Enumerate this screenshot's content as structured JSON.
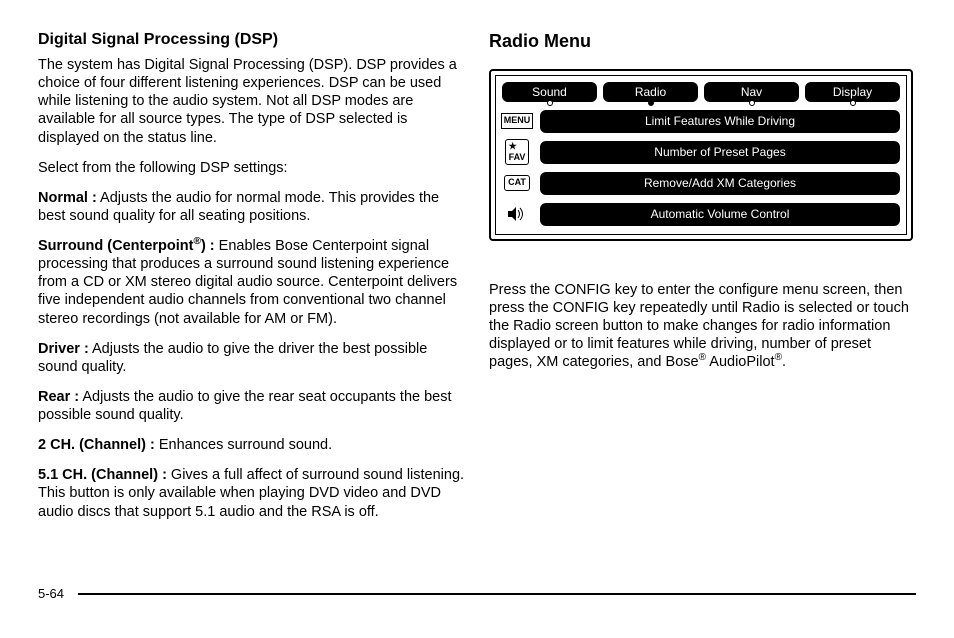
{
  "left": {
    "heading": "Digital Signal Processing (DSP)",
    "intro": "The system has Digital Signal Processing (DSP). DSP provides a choice of four different listening experiences. DSP can be used while listening to the audio system. Not all DSP modes are available for all source types. The type of DSP selected is displayed on the status line.",
    "select": "Select from the following DSP settings:",
    "normal_label": "Normal :",
    "normal_text": " Adjusts the audio for normal mode. This provides the best sound quality for all seating positions.",
    "surround_label_a": "Surround (Centerpoint",
    "surround_label_b": ") :",
    "surround_text": " Enables Bose Centerpoint signal processing that produces a surround sound listening experience from a CD or XM stereo digital audio source. Centerpoint delivers five independent audio channels from conventional two channel stereo recordings (not available for AM or FM).",
    "driver_label": "Driver :",
    "driver_text": " Adjusts the audio to give the driver the best possible sound quality.",
    "rear_label": "Rear :",
    "rear_text": " Adjusts the audio to give the rear seat occupants the best possible sound quality.",
    "ch2_label": "2 CH. (Channel) :",
    "ch2_text": " Enhances surround sound.",
    "ch51_label": "5.1 CH. (Channel) :",
    "ch51_text": " Gives a full affect of surround sound listening. This button is only available when playing DVD video and DVD audio discs that support 5.1 audio and the RSA is off."
  },
  "right": {
    "heading": "Radio Menu",
    "tabs": {
      "sound": "Sound",
      "radio": "Radio",
      "nav": "Nav",
      "display": "Display"
    },
    "menu_icon": "MENU",
    "items": {
      "limit": "Limit Features While Driving",
      "preset": "Number of Preset Pages",
      "xm": "Remove/Add XM Categories",
      "avc": "Automatic Volume Control"
    },
    "fav_icon": "FAV",
    "cat_icon": "CAT",
    "para_a": "Press the CONFIG key to enter the configure menu screen, then press the CONFIG key repeatedly until Radio is selected or touch the Radio screen button to make changes for radio information displayed or to limit features while driving, number of preset pages, XM categories, and Bose",
    "para_b": " AudioPilot",
    "para_c": "."
  },
  "page_number": "5-64"
}
